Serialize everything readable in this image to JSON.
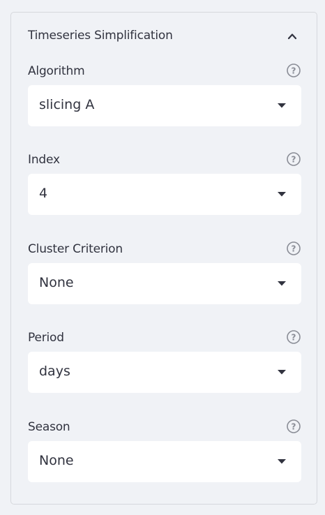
{
  "panel": {
    "title": "Timeseries Simplification",
    "expanded": true,
    "collapse_icon": "chevron-up-icon"
  },
  "fields": [
    {
      "label": "Algorithm",
      "value": "slicing A",
      "help_icon": "question-circle-icon"
    },
    {
      "label": "Index",
      "value": "4",
      "help_icon": "question-circle-icon"
    },
    {
      "label": "Cluster Criterion",
      "value": "None",
      "help_icon": "question-circle-icon"
    },
    {
      "label": "Period",
      "value": "days",
      "help_icon": "question-circle-icon"
    },
    {
      "label": "Season",
      "value": "None",
      "help_icon": "question-circle-icon"
    }
  ],
  "colors": {
    "background": "#f0f2f6",
    "text": "#31333f",
    "select_background": "#ffffff",
    "border": "#d6d8dd",
    "icon": "#8a8d96"
  }
}
